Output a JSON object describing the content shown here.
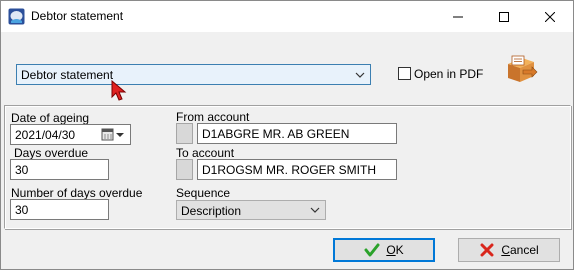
{
  "window": {
    "title": "Debtor statement"
  },
  "report": {
    "selected": "Debtor statement"
  },
  "options": {
    "open_in_pdf_label": "Open in PDF",
    "open_in_pdf_checked": false
  },
  "fields": {
    "date_of_ageing": {
      "label": "Date of ageing",
      "value": "2021/04/30"
    },
    "days_overdue": {
      "label": "Days overdue",
      "value": "30"
    },
    "number_of_days_overdue": {
      "label": "Number of days overdue",
      "value": "30"
    },
    "from_account": {
      "label": "From account",
      "value": "D1ABGRE MR. AB GREEN"
    },
    "to_account": {
      "label": "To account",
      "value": "D1ROGSM MR. ROGER SMITH"
    },
    "sequence": {
      "label": "Sequence",
      "value": "Description"
    }
  },
  "buttons": {
    "ok": {
      "mnemonic": "O",
      "rest": "K"
    },
    "cancel": {
      "mnemonic": "C",
      "rest": "ancel"
    }
  },
  "colors": {
    "focus_border": "#0078d7",
    "select_bg": "#e8f2fb",
    "ok_green": "#2aa22a",
    "cancel_red": "#d9261c"
  }
}
